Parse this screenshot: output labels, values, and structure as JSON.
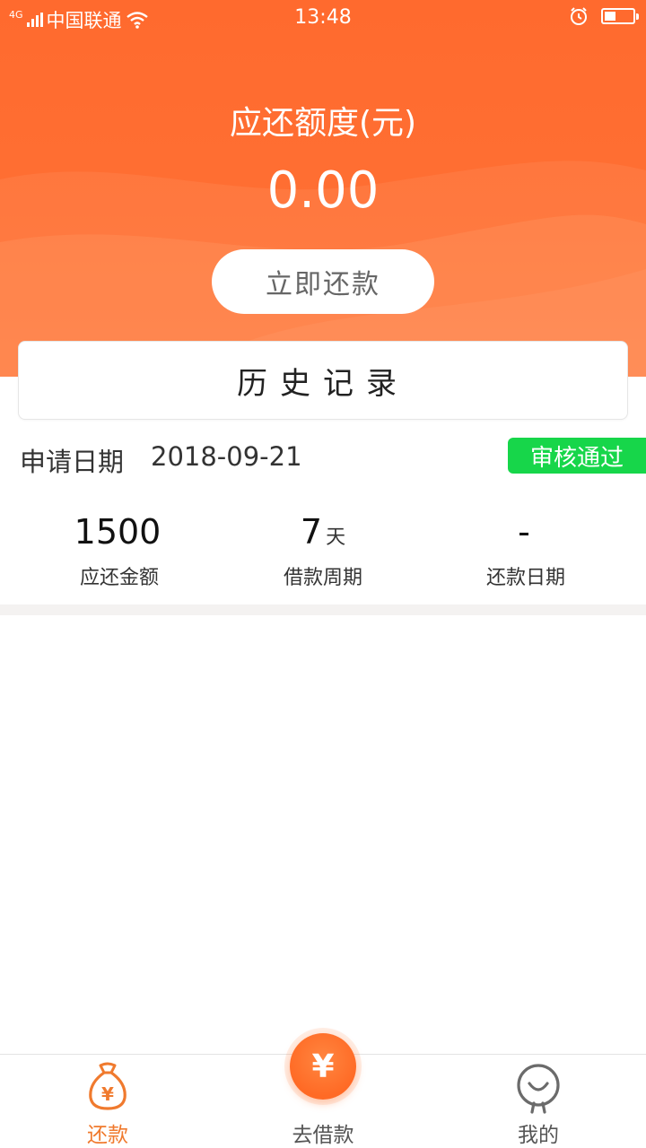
{
  "status_bar": {
    "network_type": "4G",
    "carrier": "中国联通",
    "time": "13:48"
  },
  "hero": {
    "title": "应还额度(元)",
    "amount": "0.00",
    "repay_button_label": "立即还款"
  },
  "history": {
    "title": "历史记录"
  },
  "record": {
    "apply_label": "申请日期",
    "apply_date": "2018-09-21",
    "status_badge": "审核通过",
    "status_color": "#17d64a",
    "stats": [
      {
        "value": "1500",
        "unit": "",
        "label": "应还金额"
      },
      {
        "value": "7",
        "unit": "天",
        "label": "借款周期"
      },
      {
        "value": "-",
        "unit": "",
        "label": "还款日期"
      }
    ]
  },
  "tabbar": {
    "tabs": [
      {
        "label": "还款",
        "icon": "money-bag-icon",
        "active": true
      },
      {
        "label": "去借款",
        "icon": "yen-coin-icon",
        "active": false
      },
      {
        "label": "我的",
        "icon": "person-icon",
        "active": false
      }
    ],
    "fab_symbol": "¥"
  },
  "colors": {
    "brand": "#ff6a2e",
    "active_tab": "#f07a2e"
  }
}
